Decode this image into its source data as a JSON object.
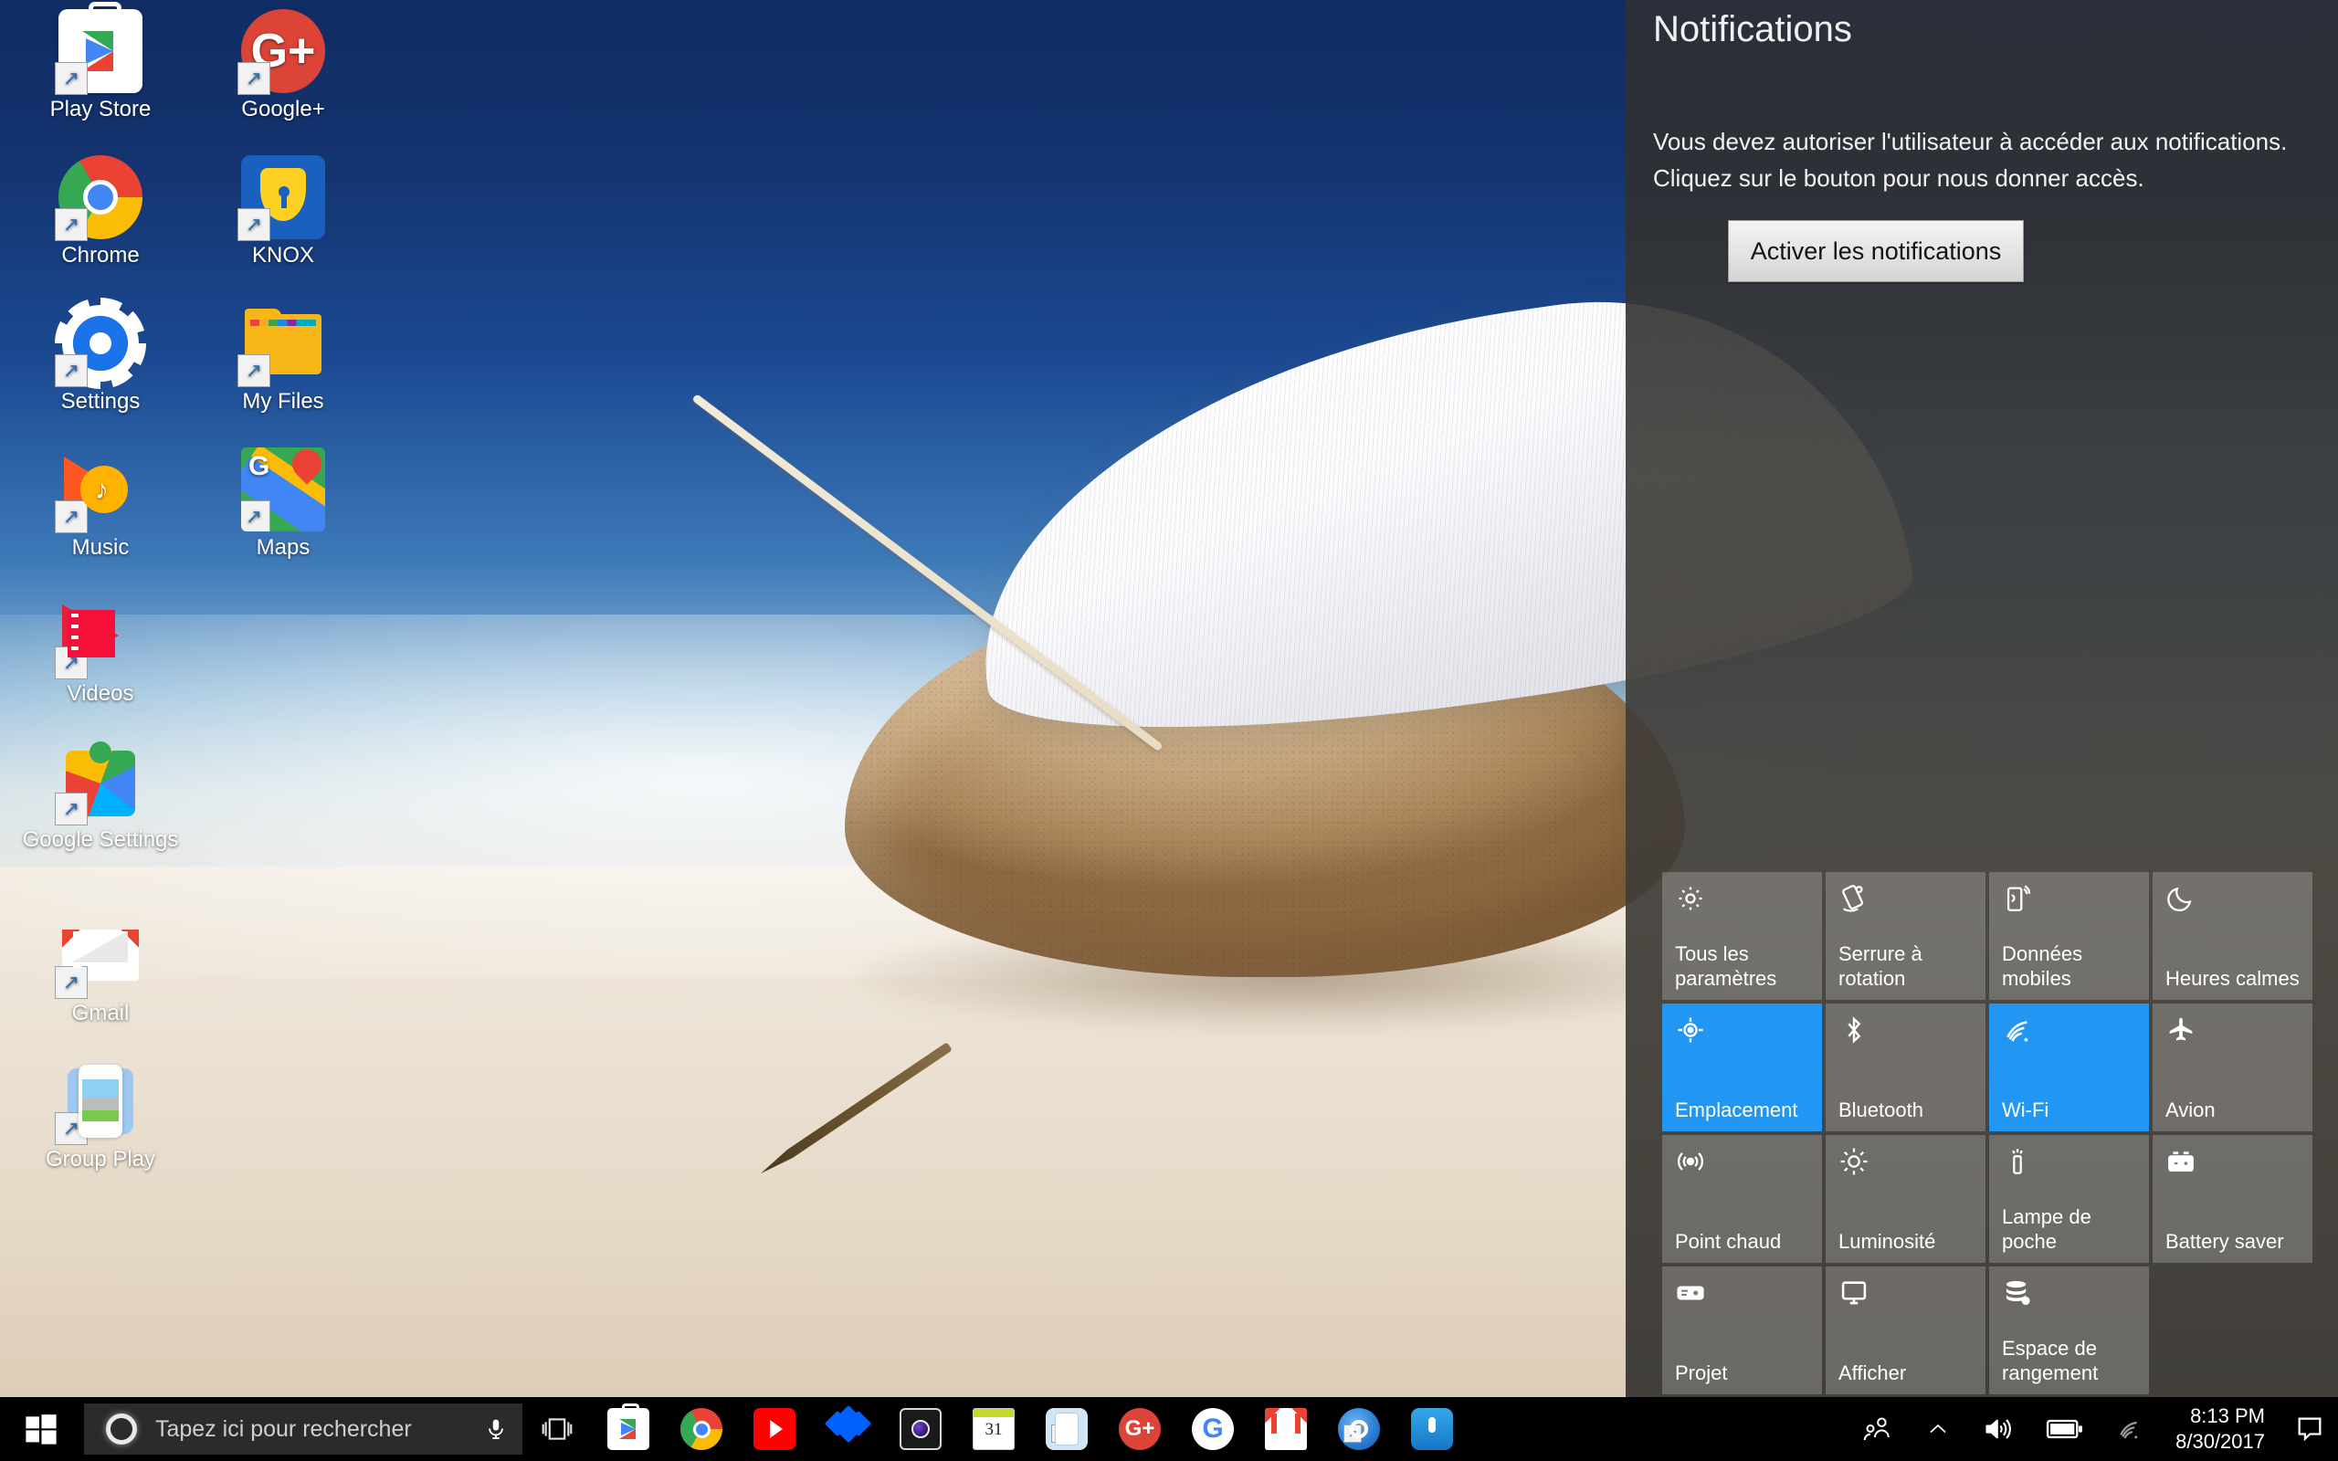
{
  "desktop": {
    "icons": [
      {
        "label": "Play Store",
        "icon": "play-store-icon"
      },
      {
        "label": "Google+",
        "icon": "google-plus-icon"
      },
      {
        "label": "Chrome",
        "icon": "chrome-icon"
      },
      {
        "label": "KNOX",
        "icon": "knox-shield-icon"
      },
      {
        "label": "Settings",
        "icon": "settings-gear-icon"
      },
      {
        "label": "My Files",
        "icon": "my-files-folder-icon"
      },
      {
        "label": "Music",
        "icon": "play-music-icon"
      },
      {
        "label": "Maps",
        "icon": "google-maps-icon"
      },
      {
        "label": "Videos",
        "icon": "play-movies-icon"
      },
      {
        "label": "Google Settings",
        "icon": "google-settings-icon"
      },
      {
        "label": "Gmail",
        "icon": "gmail-icon"
      },
      {
        "label": "Group Play",
        "icon": "group-play-icon"
      }
    ]
  },
  "notifications": {
    "title": "Notifications",
    "message": "Vous devez autoriser l'utilisateur à accéder aux notifications. Cliquez sur le bouton pour nous donner accès.",
    "enable_button": "Activer les notifications",
    "tiles": [
      {
        "label": "Tous les paramètres",
        "icon": "gear-outline-icon",
        "active": false
      },
      {
        "label": "Serrure à rotation",
        "icon": "rotation-lock-icon",
        "active": false
      },
      {
        "label": "Données mobiles",
        "icon": "mobile-data-icon",
        "active": false
      },
      {
        "label": "Heures calmes",
        "icon": "moon-icon",
        "active": false
      },
      {
        "label": "Emplacement",
        "icon": "location-crosshair-icon",
        "active": true
      },
      {
        "label": "Bluetooth",
        "icon": "bluetooth-icon",
        "active": false
      },
      {
        "label": "Wi-Fi",
        "icon": "wifi-icon",
        "active": true
      },
      {
        "label": "Avion",
        "icon": "airplane-icon",
        "active": false
      },
      {
        "label": "Point chaud",
        "icon": "hotspot-icon",
        "active": false
      },
      {
        "label": "Luminosité",
        "icon": "brightness-sun-icon",
        "active": false
      },
      {
        "label": "Lampe de poche",
        "icon": "flashlight-icon",
        "active": false
      },
      {
        "label": "Battery saver",
        "icon": "battery-saver-icon",
        "active": false
      },
      {
        "label": "Projet",
        "icon": "projector-icon",
        "active": false
      },
      {
        "label": "Afficher",
        "icon": "monitor-icon",
        "active": false
      },
      {
        "label": "Espace de rangement",
        "icon": "storage-icon",
        "active": false
      }
    ],
    "accent_color": "#2196f3",
    "tile_color": "#7a7a78"
  },
  "taskbar": {
    "start_label": "Start",
    "search_placeholder": "Tapez ici pour rechercher",
    "search_value": "",
    "cortana_label": "Cortana",
    "mic_label": "mic-icon",
    "taskview_label": "Task View",
    "apps": [
      {
        "name": "Play Store",
        "icon": "play-store-icon",
        "shortcut": false
      },
      {
        "name": "Chrome",
        "icon": "chrome-icon",
        "shortcut": false
      },
      {
        "name": "YouTube",
        "icon": "youtube-icon",
        "shortcut": false
      },
      {
        "name": "Dropbox",
        "icon": "dropbox-icon",
        "shortcut": false
      },
      {
        "name": "Camera",
        "icon": "camera-icon",
        "shortcut": false
      },
      {
        "name": "Calendar",
        "icon": "calendar-icon",
        "shortcut": false,
        "day": "31"
      },
      {
        "name": "SideSync",
        "icon": "sidesync-icon",
        "shortcut": true
      },
      {
        "name": "Google+",
        "icon": "google-plus-icon",
        "shortcut": false
      },
      {
        "name": "Google",
        "icon": "google-icon",
        "shortcut": false
      },
      {
        "name": "Gmail",
        "icon": "gmail-icon",
        "shortcut": false
      },
      {
        "name": "Smart Switch",
        "icon": "smart-switch-icon",
        "shortcut": true
      },
      {
        "name": "Voice Recorder",
        "icon": "voice-recorder-icon",
        "shortcut": false
      }
    ],
    "tray": {
      "people_label": "people-icon",
      "chevron_label": "show-hidden-icons-chevron",
      "volume_label": "volume-icon",
      "battery_label": "battery-icon",
      "wifi_label": "wifi-icon",
      "time": "8:13 PM",
      "date": "8/30/2017",
      "action_center_label": "action-center-icon"
    }
  }
}
